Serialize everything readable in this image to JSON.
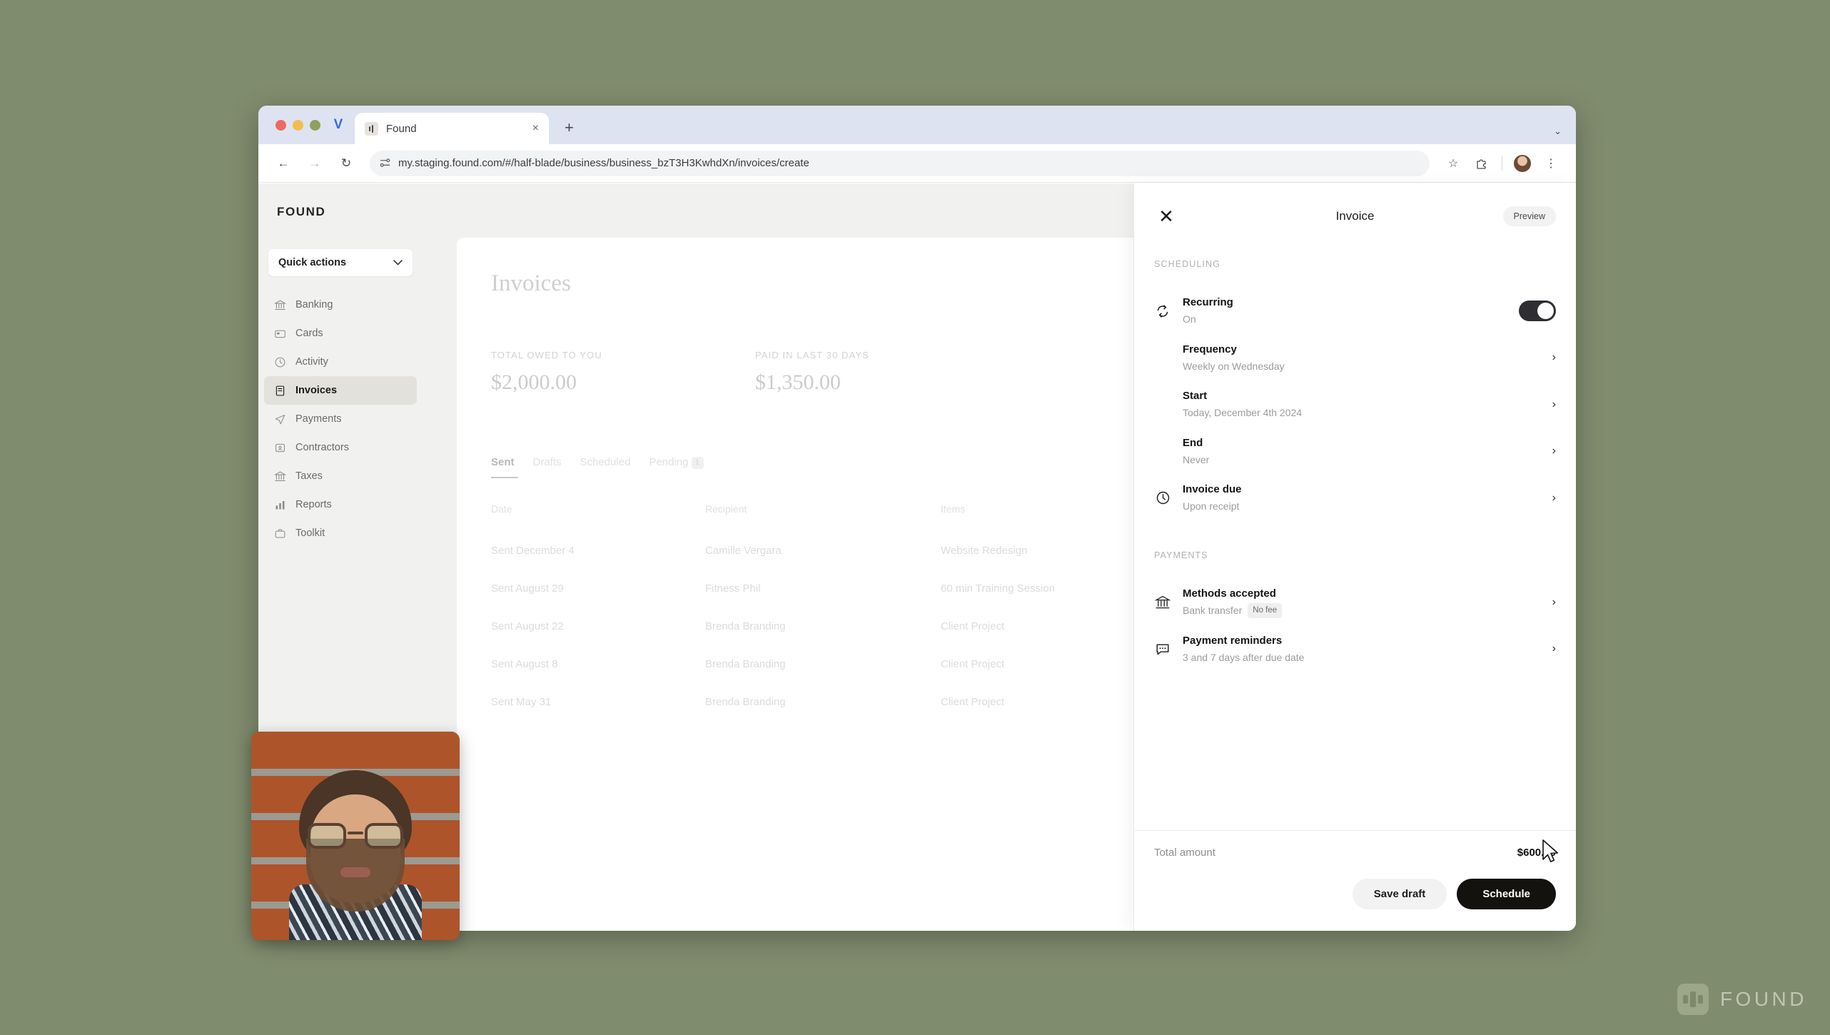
{
  "browser": {
    "tab": {
      "title": "Found",
      "close_label": "×",
      "favicon": "found-favicon"
    },
    "new_tab_label": "+",
    "tabstrip_expand": "⌄",
    "nav": {
      "back": "←",
      "forward": "→",
      "reload": "↻"
    },
    "omnibox": {
      "url": "my.staging.found.com/#/half-blade/business/business_bzT3H3KwhdXn/invoices/create",
      "site_settings_icon": "tune-icon"
    },
    "actions": {
      "bookmark": "☆",
      "extensions": "extensions-icon",
      "menu": "⋮"
    }
  },
  "sidebar": {
    "brand": "FOUND",
    "quick_actions": {
      "label": "Quick actions",
      "chevron": "⌄"
    },
    "items": [
      {
        "label": "Banking",
        "icon": "bank-icon",
        "active": false
      },
      {
        "label": "Cards",
        "icon": "card-icon",
        "active": false
      },
      {
        "label": "Activity",
        "icon": "clock-icon",
        "active": false
      },
      {
        "label": "Invoices",
        "icon": "invoice-icon",
        "active": true
      },
      {
        "label": "Payments",
        "icon": "send-icon",
        "active": false
      },
      {
        "label": "Contractors",
        "icon": "contractor-icon",
        "active": false
      },
      {
        "label": "Taxes",
        "icon": "taxes-icon",
        "active": false
      },
      {
        "label": "Reports",
        "icon": "bar-chart-icon",
        "active": false
      },
      {
        "label": "Toolkit",
        "icon": "toolkit-icon",
        "active": false
      }
    ]
  },
  "main": {
    "title": "Invoices",
    "stats": [
      {
        "label": "TOTAL OWED TO YOU",
        "value": "$2,000.00"
      },
      {
        "label": "PAID IN LAST 30 DAYS",
        "value": "$1,350.00"
      }
    ],
    "tabs": [
      {
        "label": "Sent",
        "active": true,
        "badge": null
      },
      {
        "label": "Drafts",
        "active": false,
        "badge": null
      },
      {
        "label": "Scheduled",
        "active": false,
        "badge": null
      },
      {
        "label": "Pending",
        "active": false,
        "badge": "1"
      }
    ],
    "table": {
      "columns": [
        "Date",
        "Recipient",
        "Items"
      ],
      "rows": [
        {
          "date": "Sent December 4",
          "recipient": "Camille Vergara",
          "items": "Website Redesign"
        },
        {
          "date": "Sent August 29",
          "recipient": "Fitness Phil",
          "items": "60 min Training Session"
        },
        {
          "date": "Sent August 22",
          "recipient": "Brenda Branding",
          "items": "Client Project"
        },
        {
          "date": "Sent August 8",
          "recipient": "Brenda Branding",
          "items": "Client Project"
        },
        {
          "date": "Sent May 31",
          "recipient": "Brenda Branding",
          "items": "Client Project"
        }
      ]
    }
  },
  "drawer": {
    "close_label": "✕",
    "title": "Invoice",
    "preview_label": "Preview",
    "sections": [
      {
        "label": "SCHEDULING"
      },
      {
        "label": "PAYMENTS"
      }
    ],
    "scheduling_label": "SCHEDULING",
    "payments_label": "PAYMENTS",
    "recurring": {
      "title": "Recurring",
      "subtitle": "On",
      "icon": "recurring-icon",
      "toggle_state": "on"
    },
    "frequency": {
      "title": "Frequency",
      "subtitle": "Weekly on Wednesday",
      "chevron": "›"
    },
    "start": {
      "title": "Start",
      "subtitle": "Today, December 4th 2024",
      "chevron": "›"
    },
    "end": {
      "title": "End",
      "subtitle": "Never",
      "chevron": "›"
    },
    "invoice_due": {
      "title": "Invoice due",
      "subtitle": "Upon receipt",
      "icon": "clock-icon",
      "chevron": "›"
    },
    "methods_accepted": {
      "title": "Methods accepted",
      "subtitle": "Bank transfer",
      "pill": "No fee",
      "icon": "bank-icon",
      "chevron": "›"
    },
    "payment_reminders": {
      "title": "Payment reminders",
      "subtitle": "3 and 7 days after due date",
      "icon": "chat-icon",
      "chevron": "›"
    },
    "footer": {
      "total_label": "Total amount",
      "total_value": "$600.00",
      "save_draft_label": "Save draft",
      "schedule_label": "Schedule"
    }
  },
  "watermark": {
    "text": "FOUND",
    "mark": "found-logo-icon"
  },
  "colors": {
    "page_background": "#808c6e",
    "accent_dark": "#14120f",
    "toggle_on": "#2e2e33",
    "sidebar_background": "#f1f1ef",
    "active_nav": "#e3e1dc"
  }
}
